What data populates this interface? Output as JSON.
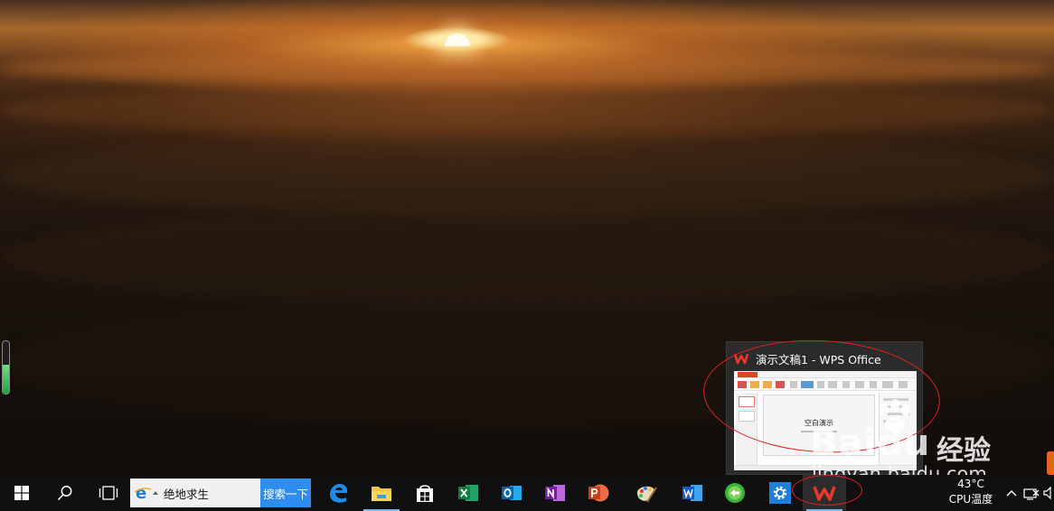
{
  "desktop": {
    "side_meter_level": 0.55
  },
  "preview": {
    "window_title": "演示文稿1 - WPS Office",
    "slide_title": "空白演示"
  },
  "watermark": {
    "logo_text": "Baidu",
    "logo_cn": "经验",
    "url": "jingyan.baidu.com"
  },
  "taskbar": {
    "search_value": "绝地求生",
    "search_button_label": "搜索一下",
    "apps": [
      {
        "name": "edge-icon"
      },
      {
        "name": "file-explorer-icon"
      },
      {
        "name": "store-icon"
      },
      {
        "name": "excel-icon"
      },
      {
        "name": "outlook-icon"
      },
      {
        "name": "onenote-icon"
      },
      {
        "name": "powerpoint-icon"
      },
      {
        "name": "paint-icon"
      },
      {
        "name": "word-icon"
      },
      {
        "name": "green-app-icon"
      },
      {
        "name": "settings-icon"
      },
      {
        "name": "wps-icon"
      }
    ],
    "tray": {
      "temperature": "43°C",
      "temperature_label": "CPU温度"
    }
  },
  "colors": {
    "taskbar_bg": "#101010",
    "accent_underline": "#76b9ed",
    "annotation": "#e02020",
    "search_button": "#2f8df0"
  }
}
